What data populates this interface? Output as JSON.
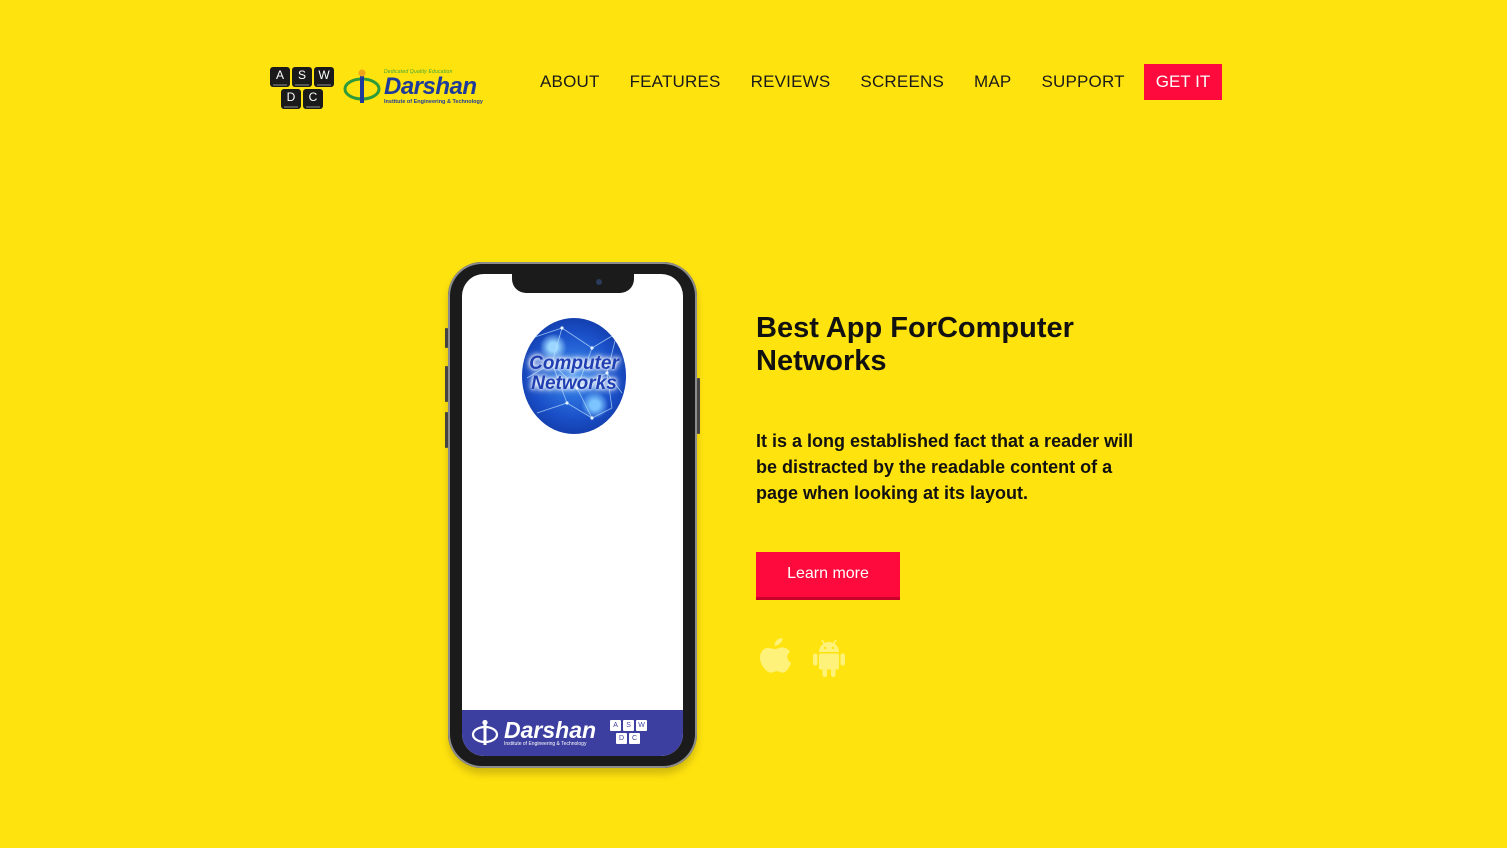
{
  "header": {
    "logo": {
      "keys": [
        "A",
        "S",
        "W",
        "D",
        "C"
      ],
      "tagline": "Dedicated Quality Education",
      "name": "Darshan",
      "subtitle": "Institute of Engineering & Technology"
    },
    "nav": [
      "ABOUT",
      "FEATURES",
      "REVIEWS",
      "SCREENS",
      "MAP",
      "SUPPORT"
    ],
    "cta": "GET IT"
  },
  "phone": {
    "app_title_line1": "Computer",
    "app_title_line2": "Networks",
    "footer_name": "Darshan",
    "footer_sub": "Institute of Engineering & Technology"
  },
  "hero": {
    "title_light": "Best App For",
    "title_bold": "Computer Networks",
    "description": "It is a long established fact that a reader will be distracted by the readable content of a page when looking at its layout.",
    "button": "Learn more",
    "store_icons": [
      "apple-icon",
      "android-icon"
    ]
  },
  "colors": {
    "background": "#FFE30F",
    "accent": "#FF0A3C",
    "brand_blue": "#1e3a9a"
  }
}
